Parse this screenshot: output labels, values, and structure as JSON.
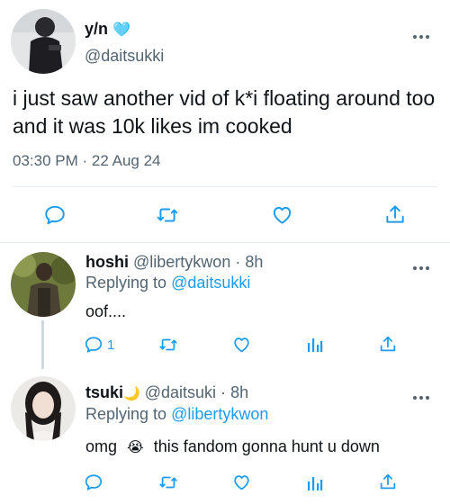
{
  "main_tweet": {
    "display_name": "y/n",
    "verified_emoji": "🩵",
    "handle": "@daitsukki",
    "text": "i just saw another vid of k*i floating around too and it was 10k likes im cooked",
    "time": "03:30 PM",
    "separator": "·",
    "date": "22 Aug 24",
    "actions": [
      "reply-icon",
      "retweet-icon",
      "like-icon",
      "share-icon"
    ]
  },
  "replies": [
    {
      "display_name": "hoshi",
      "handle": "@libertykwon",
      "separator": "·",
      "time": "8h",
      "replying_label": "Replying to",
      "replying_to": "@daitsukki",
      "text": "oof....",
      "reply_count": "1",
      "actions": [
        "reply-icon",
        "retweet-icon",
        "like-icon",
        "analytics-icon",
        "share-icon"
      ]
    },
    {
      "display_name": "tsuki",
      "name_emoji": "🌙",
      "handle": "@daitsuki",
      "separator": "·",
      "time": "8h",
      "replying_label": "Replying to",
      "replying_to": "@libertykwon",
      "text_before": "omg",
      "text_emoji": "😭",
      "text_after": "this fandom gonna hunt u down",
      "actions": [
        "reply-icon",
        "retweet-icon",
        "like-icon",
        "analytics-icon",
        "share-icon"
      ]
    }
  ],
  "colors": {
    "accent": "#1d9bf0",
    "muted": "#536471",
    "text": "#0f1419",
    "divider": "#e6ecf0",
    "thread_line": "#cfd9de"
  }
}
